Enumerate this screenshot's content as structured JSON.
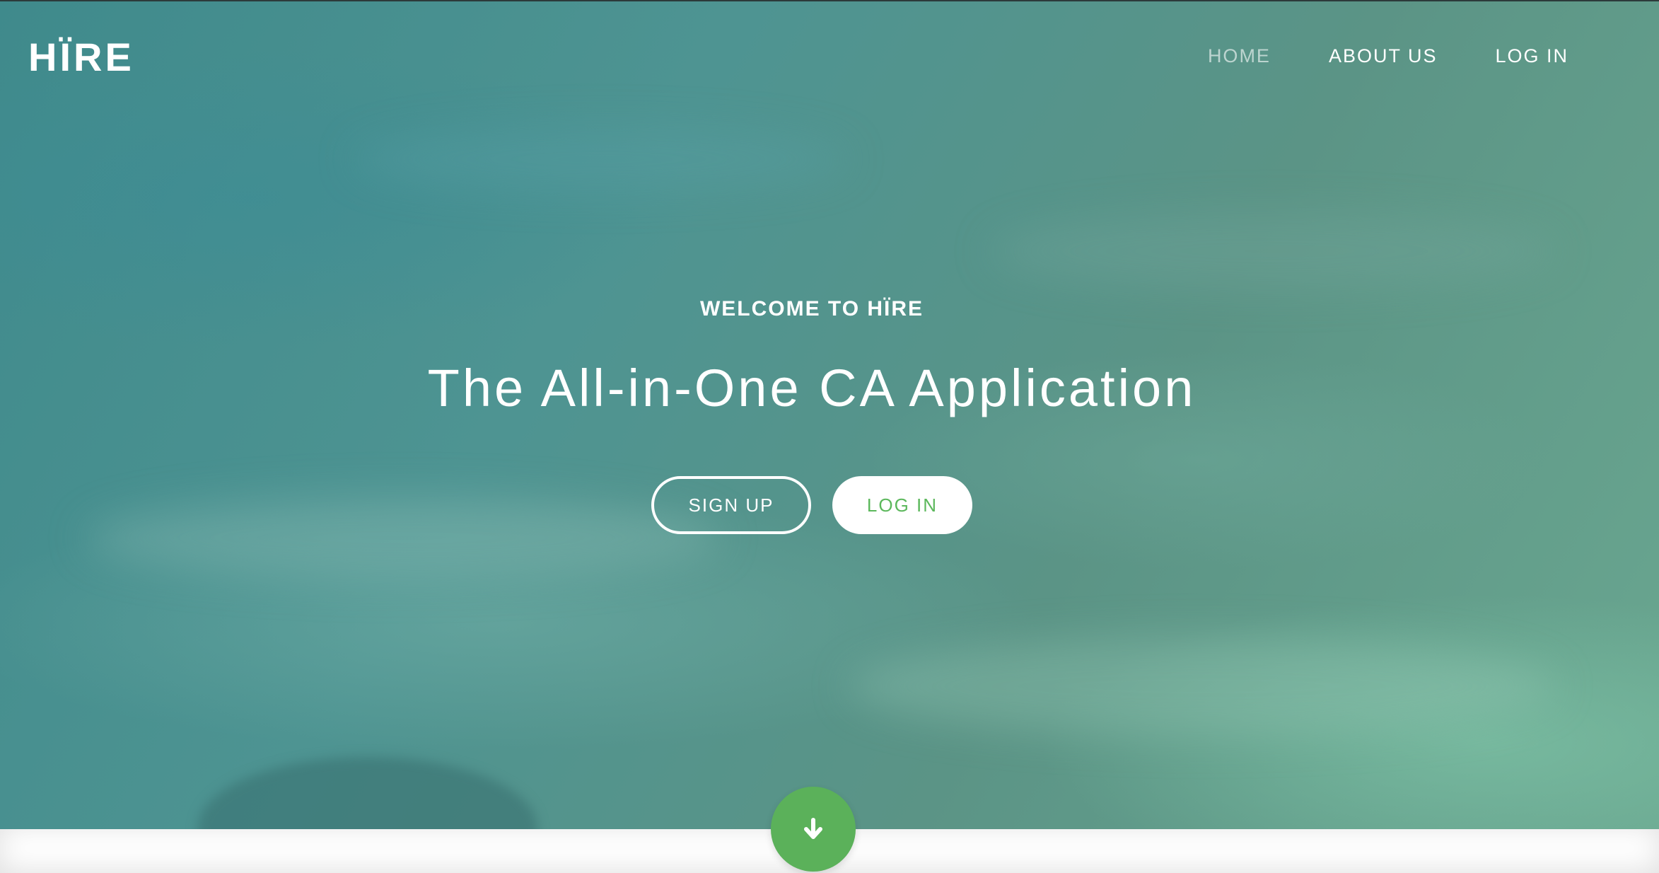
{
  "brand": {
    "logo": "HÏRE"
  },
  "nav": {
    "items": [
      {
        "label": "HOME",
        "active": true
      },
      {
        "label": "ABOUT US",
        "active": false
      },
      {
        "label": "LOG IN",
        "active": false
      }
    ]
  },
  "hero": {
    "eyebrow": "WELCOME TO HÏRE",
    "headline": "The All-in-One CA Application",
    "signup_label": "SIGN UP",
    "login_label": "LOG IN"
  },
  "scroll": {
    "icon": "arrow-down-icon"
  },
  "colors": {
    "accent_green": "#5cb85c",
    "hero_teal": "#4e9492",
    "text_white": "#ffffff"
  }
}
